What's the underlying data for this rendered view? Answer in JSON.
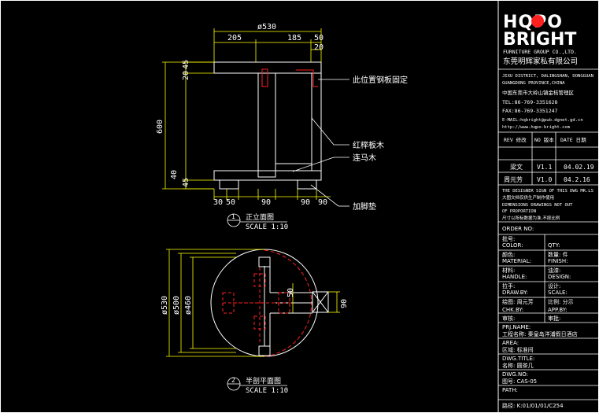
{
  "brand": {
    "logo": "HQPO BRIGHT",
    "group_en": "FURNITURE GROUP CO.,LTD.",
    "group_cn": "东莞明辉家私有限公司"
  },
  "company": {
    "addr_en1": "JIXU DISTRICT, DALINGSHAN, DONGGUAN",
    "addr_en2": "GUANGDONG PROVINCE,CHINA",
    "addr_cn": "中国东莞市大岭山镇金桔管理区",
    "tel": "TEL:86-769-3351628",
    "fax": "FAX:86-769-3351247",
    "email": "E-MAIL:hqbright@pub.dgnet.gd.cn",
    "web": "http://www.hqpo-bright.com"
  },
  "revision": {
    "header": [
      "REV 修改",
      "NO 版本",
      "DATE 日期"
    ],
    "rows": [
      {
        "name": "梁文",
        "ver": "V1.1",
        "date": "04.02.19"
      },
      {
        "name": "周元芳",
        "ver": "V1.0",
        "date": "04.2.16"
      }
    ]
  },
  "notes": [
    "THE DESIGNER SIGN OF THIS DWG MR.LS",
    "大图文档仅供生产制作使用",
    "DIMENSIONS DRAWINGS NOT OUT",
    "OF PROPORTION",
    "尺寸以所标数据为准,不按比例"
  ],
  "fields": [
    {
      "label": "ORDER NO:",
      "value": ""
    },
    {
      "label": "批号:",
      "value": ""
    },
    {
      "label": "COLOR:",
      "value": "QTY:"
    },
    {
      "label": "颜色:",
      "value": "数量:   件"
    },
    {
      "label": "MATERIAL:",
      "value": "FINISH:"
    },
    {
      "label": "材料:",
      "value": "油漆:"
    },
    {
      "label": "HANDLE:",
      "value": "DESIGN:"
    },
    {
      "label": "拉手:",
      "value": "设计:"
    },
    {
      "label": "DRAW.BY:",
      "value": "SCALE:"
    },
    {
      "label": "绘图: 周元芳",
      "value": "比例: 分示"
    },
    {
      "label": "CHK.BY:",
      "value": "APP.BY:"
    },
    {
      "label": "审核:",
      "value": "审批:"
    }
  ],
  "project": {
    "prj_label": "PRJ.NAME:",
    "prj_value": "工程名称:  秦皇岛洋浦假日酒店",
    "area_label": "AREA:",
    "area_value": "区域:    标准间",
    "dwg_label": "DWG.TITLE:",
    "dwg_value": "名称:    圆茶几",
    "dwgno_label": "DWG.NO:",
    "dwgno_value": "图号:    CAS-05",
    "path_label": "PATH:",
    "path_value": "路径:    K:01/01/01/C254"
  },
  "front_view": {
    "dims_top": [
      "ø530",
      "205",
      "185",
      "50",
      "20"
    ],
    "dims_left": [
      "45",
      "20",
      "600",
      "40",
      "45"
    ],
    "dims_bottom": [
      "30",
      "50",
      "90",
      "90",
      "90"
    ],
    "callouts": [
      "此位置钢板固定",
      "红榉板木",
      "连马木",
      "加脚垫"
    ],
    "title_num": "1",
    "title": "正立面图",
    "scale": "SCALE 1:10"
  },
  "plan_view": {
    "dims": [
      "ø530",
      "ø500",
      "ø460",
      "50",
      "90"
    ],
    "title_num": "2",
    "title": "半剖平面图",
    "scale": "SCALE 1:10"
  },
  "colors": {
    "line": "#ffffff",
    "dim": "#ffff00",
    "text": "#ffffff",
    "hidden": "#ff2020",
    "frame": "#ffffff"
  }
}
